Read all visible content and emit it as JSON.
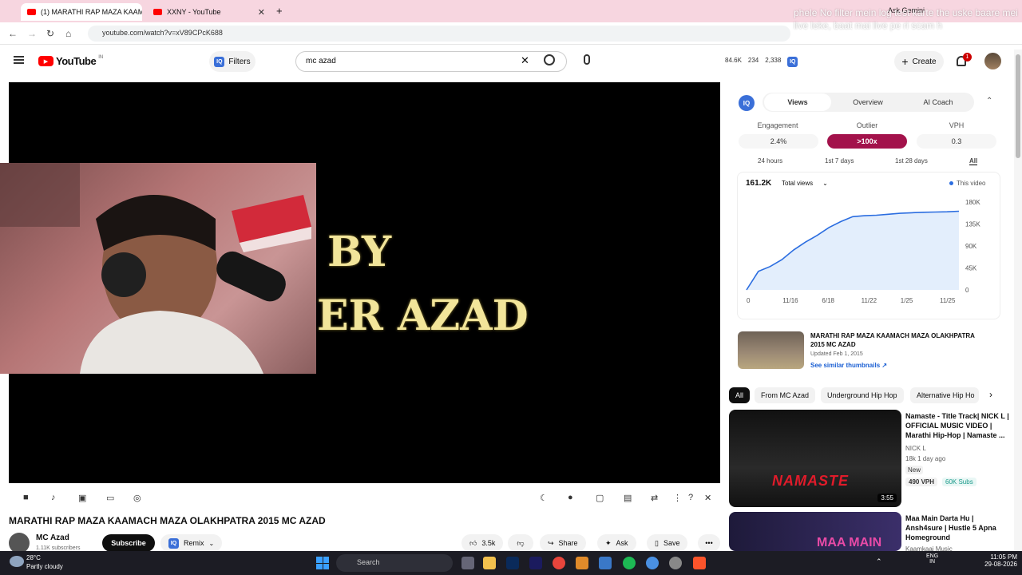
{
  "browser": {
    "tabs": [
      {
        "label": "(1) MARATHI RAP MAZA KAAM"
      },
      {
        "label": "XXNY - YouTube"
      }
    ],
    "new_tab": "+",
    "url": "youtube.com/watch?v=xV89CPcK688",
    "ask_gemini": "Ask Gemini"
  },
  "overlay_text": "phele No filter mein log test karte the uske baare mei live leke, baat mai live pe ri scam h",
  "header": {
    "logo": "YouTube",
    "region": "IN",
    "filters_label": "Filters",
    "search_value": "mc azad",
    "stat1": "84.6K",
    "stat2": "234",
    "stat3": "2,338",
    "create_label": "Create",
    "notif_count": "1"
  },
  "video_overlay": {
    "line1": "BY",
    "line2": "ER AZAD"
  },
  "video": {
    "title": "MARATHI RAP MAZA KAAMACH MAZA OLAKHPATRA 2015 MC AZAD",
    "channel": "MC Azad",
    "subscribers": "1.11K subscribers",
    "subscribe_label": "Subscribe",
    "remix_label": "Remix",
    "likes": "3.5k",
    "share_label": "Share",
    "ask_label": "Ask",
    "save_label": "Save"
  },
  "panel": {
    "tabs": [
      "Views",
      "Overview",
      "AI Coach"
    ],
    "metrics": [
      {
        "label": "Engagement",
        "value": "2.4%"
      },
      {
        "label": "Outlier",
        "value": ">100x"
      },
      {
        "label": "VPH",
        "value": "0.3"
      }
    ],
    "ranges": [
      "24 hours",
      "1st 7 days",
      "1st 28 days",
      "All"
    ],
    "total": "161.2K",
    "dropdown": "Total views",
    "legend": "This video",
    "video_title": "MARATHI RAP MAZA KAAMACH MAZA OLAKHPATRA 2015 MC AZAD",
    "updated": "Updated Feb 1, 2015",
    "similar_link": "See similar thumbnails ↗"
  },
  "chart_data": {
    "type": "line",
    "x_ticks": [
      "0",
      "11/16",
      "6/18",
      "11/22",
      "1/25",
      "11/25"
    ],
    "y_ticks": [
      "180K",
      "135K",
      "90K",
      "45K",
      "0"
    ],
    "ylim": [
      0,
      180000
    ],
    "series": [
      {
        "name": "This video",
        "values": [
          0,
          38000,
          48000,
          62000,
          82000,
          98000,
          112000,
          128000,
          140000,
          150000,
          152000,
          153000,
          155000,
          157000,
          158000,
          159000,
          159500,
          160000,
          161200
        ]
      }
    ]
  },
  "chips": [
    "All",
    "From MC Azad",
    "Underground Hip Hop",
    "Alternative Hip Ho"
  ],
  "recs": [
    {
      "title": "Namaste - Title Track| NICK L | OFFICIAL MUSIC VIDEO | Marathi Hip-Hop | Namaste ...",
      "channel": "NICK L",
      "meta": "18k  1 day ago",
      "badge": "New",
      "vph": "490 VPH",
      "subs": "60K Subs",
      "duration": "3:55",
      "thumb_text": "NAMASTE"
    },
    {
      "title": "Maa Main Darta Hu | Ansh4sure | Hustle 5 Apna Homeground",
      "channel": "Kaamkaaj Music",
      "thumb_text": "MAA MAIN"
    }
  ],
  "taskbar": {
    "temp": "28°C",
    "weather": "Partly cloudy",
    "search": "Search",
    "lang1": "ENG",
    "lang2": "IN",
    "time": "11:05 PM",
    "date": "29-08-2026"
  }
}
